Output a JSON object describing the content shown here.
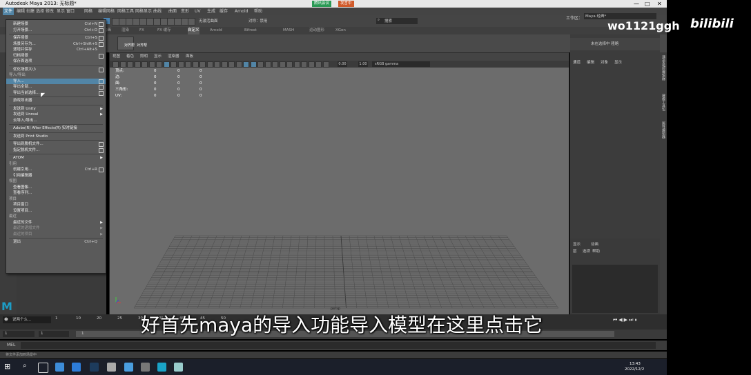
{
  "window": {
    "title": "Autodesk Maya 2013: 无标题*",
    "sharing_tag": "腾讯会议",
    "speaker_tag": "发言中"
  },
  "menubar": {
    "items": [
      "文件",
      "编辑",
      "创建",
      "选择",
      "修改",
      "显示",
      "窗口",
      "网格",
      "编辑网格",
      "网格工具",
      "网格显示",
      "曲线",
      "曲面",
      "变形",
      "UV",
      "生成",
      "缓存",
      "Arnold",
      "帮助"
    ],
    "workspace_label": "工作区：",
    "workspace_value": "Maya 经典*"
  },
  "status_row": {
    "mode_label": "无激活曲面",
    "symmetry_label": "对称：禁用",
    "search_placeholder": "搜索"
  },
  "shelf": {
    "tabs": [
      "动画",
      "渲染",
      "FX",
      "FX 缓存",
      "自定义",
      "Arnold",
      "Bifrost",
      "MASH",
      "运动图形",
      "XGen"
    ],
    "tool_label": "对齐帮",
    "tool_label2": "对齐帮"
  },
  "file_menu": {
    "items": [
      {
        "type": "item",
        "label": "新建场景",
        "shortcut": "Ctrl+N",
        "option": true
      },
      {
        "type": "item",
        "label": "打开场景...",
        "shortcut": "Ctrl+O",
        "option": true
      },
      {
        "type": "sep"
      },
      {
        "type": "item",
        "label": "保存场景",
        "shortcut": "Ctrl+S",
        "option": true
      },
      {
        "type": "item",
        "label": "场景另存为...",
        "shortcut": "Ctrl+Shift+S",
        "option": true
      },
      {
        "type": "item",
        "label": "递增并保存",
        "shortcut": "Ctrl+Alt+S",
        "option": false
      },
      {
        "type": "item",
        "label": "归档场景",
        "shortcut": "",
        "option": true
      },
      {
        "type": "item",
        "label": "保存首选项",
        "shortcut": "",
        "option": false
      },
      {
        "type": "sep"
      },
      {
        "type": "item",
        "label": "优化场景大小",
        "shortcut": "",
        "option": true
      },
      {
        "type": "section",
        "label": "导入/导出"
      },
      {
        "type": "item",
        "label": "导入...",
        "shortcut": "",
        "option": true,
        "highlight": true
      },
      {
        "type": "item",
        "label": "导出全部...",
        "shortcut": "",
        "option": true
      },
      {
        "type": "item",
        "label": "导出当前选择...",
        "shortcut": "",
        "option": true
      },
      {
        "type": "sep"
      },
      {
        "type": "item",
        "label": "游戏导出器",
        "shortcut": "",
        "option": false
      },
      {
        "type": "sep"
      },
      {
        "type": "item",
        "label": "发送到 Unity",
        "shortcut": "",
        "arrow": true
      },
      {
        "type": "item",
        "label": "发送到 Unreal",
        "shortcut": "",
        "arrow": true
      },
      {
        "type": "item",
        "label": "云导入/导出...",
        "shortcut": "",
        "option": false
      },
      {
        "type": "sep"
      },
      {
        "type": "item",
        "label": "Adobe(R) After Effects(R) 实时链接",
        "shortcut": "",
        "option": false
      },
      {
        "type": "sep"
      },
      {
        "type": "item",
        "label": "发送到 Print Studio",
        "shortcut": "",
        "option": false
      },
      {
        "type": "sep"
      },
      {
        "type": "item",
        "label": "导出到脱机文件...",
        "shortcut": "",
        "option": true
      },
      {
        "type": "item",
        "label": "指定脱机文件...",
        "shortcut": "",
        "option": true
      },
      {
        "type": "sep"
      },
      {
        "type": "item",
        "label": "ATOM",
        "shortcut": "",
        "arrow": true
      },
      {
        "type": "section",
        "label": "引用"
      },
      {
        "type": "item",
        "label": "创建引用...",
        "shortcut": "Ctrl+R",
        "option": true
      },
      {
        "type": "item",
        "label": "引用编辑器",
        "shortcut": "",
        "option": false
      },
      {
        "type": "section",
        "label": "视图"
      },
      {
        "type": "item",
        "label": "查看图像...",
        "shortcut": "",
        "option": false
      },
      {
        "type": "item",
        "label": "查看序列...",
        "shortcut": "",
        "option": false
      },
      {
        "type": "section",
        "label": "项目"
      },
      {
        "type": "item",
        "label": "项目窗口",
        "shortcut": "",
        "option": false
      },
      {
        "type": "item",
        "label": "设置项目...",
        "shortcut": "",
        "option": false
      },
      {
        "type": "section",
        "label": "最近"
      },
      {
        "type": "item",
        "label": "最近的文件",
        "shortcut": "",
        "arrow": true
      },
      {
        "type": "item",
        "label": "最近的递增文件",
        "shortcut": "",
        "arrow": true,
        "dim": true
      },
      {
        "type": "item",
        "label": "最近的项目",
        "shortcut": "",
        "arrow": true,
        "dim": true
      },
      {
        "type": "sep"
      },
      {
        "type": "item",
        "label": "退出",
        "shortcut": "Ctrl+Q",
        "option": false
      }
    ]
  },
  "viewport": {
    "menu": [
      "视图",
      "着色",
      "照明",
      "显示",
      "渲染器",
      "面板"
    ],
    "hud_rows": [
      {
        "label": "顶点:",
        "v1": "0",
        "v2": "0",
        "v3": "0"
      },
      {
        "label": "边:",
        "v1": "0",
        "v2": "0",
        "v3": "0"
      },
      {
        "label": "面:",
        "v1": "0",
        "v2": "0",
        "v3": "0"
      },
      {
        "label": "三角形:",
        "v1": "0",
        "v2": "0",
        "v3": "0"
      },
      {
        "label": "UV:",
        "v1": "0",
        "v2": "0",
        "v3": "0"
      }
    ],
    "value1": "0.00",
    "value2": "1.00",
    "colorspace": "sRGB gamma",
    "camera_label": "persp"
  },
  "right_panel": {
    "title": "未在选择中 粗略",
    "tabs": [
      "通道",
      "编辑",
      "对象",
      "显示"
    ],
    "layer_tabs": [
      "显示",
      "动画"
    ],
    "layer_menu": [
      "层",
      "选项",
      "帮助"
    ],
    "side_tabs": [
      "通道盒/层编辑器",
      "建模工具包",
      "属性编辑器"
    ]
  },
  "timeline": {
    "ticks": [
      "1",
      "10",
      "20",
      "25",
      "30",
      "35",
      "40",
      "45",
      "50"
    ]
  },
  "range_row": {
    "start": "1",
    "end": "1",
    "value": "1"
  },
  "mel": {
    "label": "MEL"
  },
  "help_line": {
    "text": "将文件添加到场景中"
  },
  "search_box": {
    "text": "说两个么..."
  },
  "taskbar": {
    "time": "13:43",
    "date": "2022/12/2"
  },
  "subtitle": {
    "text": "好首先maya的导入功能导入模型在这里点击它"
  },
  "watermark": {
    "user": "wo1121ggh",
    "brand": "bilibili"
  }
}
